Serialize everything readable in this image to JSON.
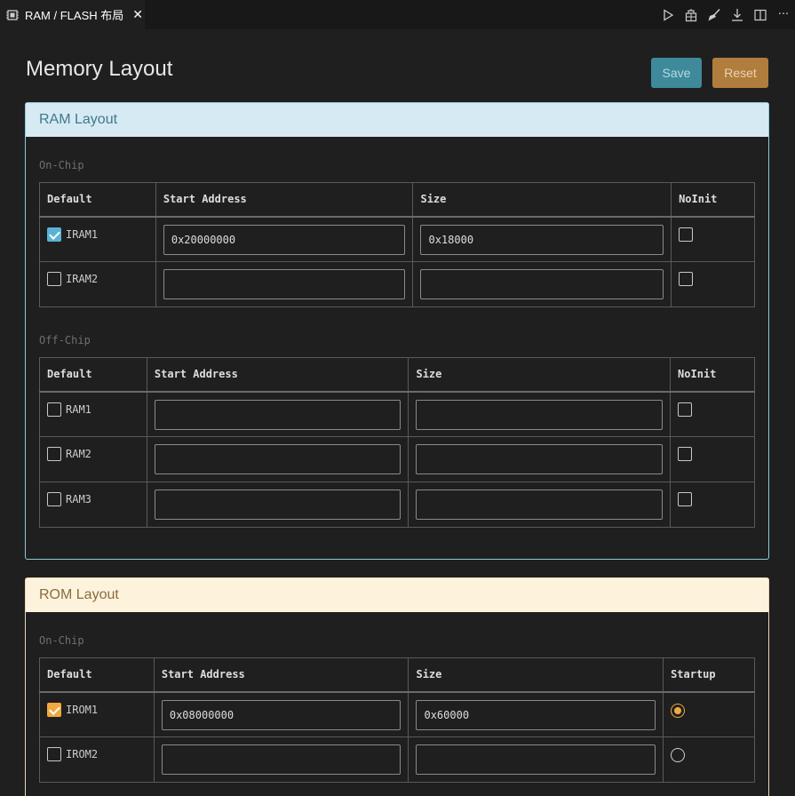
{
  "tab": {
    "title": "RAM / FLASH 布局",
    "close": "✕",
    "icon": "chip-icon"
  },
  "toolbar": {
    "actions": [
      "run-icon",
      "build-icon",
      "clean-icon",
      "download-icon",
      "split-editor-icon",
      "more-icon"
    ],
    "more_label": "···"
  },
  "page": {
    "title": "Memory Layout",
    "save_label": "Save",
    "reset_label": "Reset"
  },
  "ram": {
    "header": "RAM Layout",
    "accent": "#5ab3d6",
    "onchip": {
      "label": "On-Chip",
      "columns": [
        "Default",
        "Start Address",
        "Size",
        "NoInit"
      ],
      "rows": [
        {
          "name": "IRAM1",
          "default": true,
          "start": "0x20000000",
          "size": "0x18000",
          "noinit": false
        },
        {
          "name": "IRAM2",
          "default": false,
          "start": "",
          "size": "",
          "noinit": false
        }
      ]
    },
    "offchip": {
      "label": "Off-Chip",
      "columns": [
        "Default",
        "Start Address",
        "Size",
        "NoInit"
      ],
      "rows": [
        {
          "name": "RAM1",
          "default": false,
          "start": "",
          "size": "",
          "noinit": false
        },
        {
          "name": "RAM2",
          "default": false,
          "start": "",
          "size": "",
          "noinit": false
        },
        {
          "name": "RAM3",
          "default": false,
          "start": "",
          "size": "",
          "noinit": false
        }
      ]
    }
  },
  "rom": {
    "header": "ROM Layout",
    "accent": "#f0a940",
    "onchip": {
      "label": "On-Chip",
      "columns": [
        "Default",
        "Start Address",
        "Size",
        "Startup"
      ],
      "rows": [
        {
          "name": "IROM1",
          "default": true,
          "start": "0x08000000",
          "size": "0x60000",
          "startup": true
        },
        {
          "name": "IROM2",
          "default": false,
          "start": "",
          "size": "",
          "startup": false
        }
      ]
    }
  }
}
